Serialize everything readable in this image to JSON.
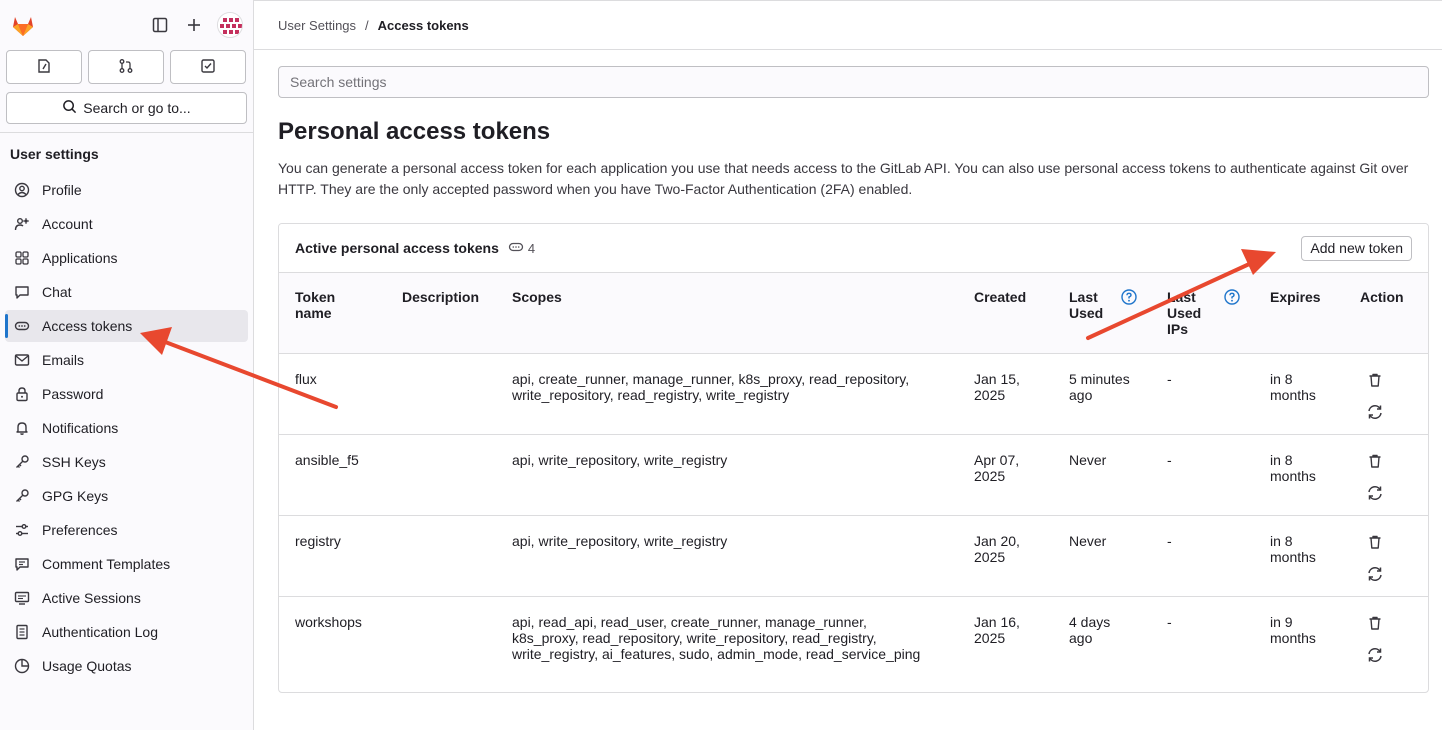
{
  "sidebar": {
    "search_label": "Search or go to...",
    "heading": "User settings",
    "items": [
      {
        "label": "Profile",
        "icon": "profile-icon"
      },
      {
        "label": "Account",
        "icon": "account-icon"
      },
      {
        "label": "Applications",
        "icon": "applications-icon"
      },
      {
        "label": "Chat",
        "icon": "chat-icon"
      },
      {
        "label": "Access tokens",
        "icon": "token-icon",
        "active": true
      },
      {
        "label": "Emails",
        "icon": "mail-icon"
      },
      {
        "label": "Password",
        "icon": "lock-icon"
      },
      {
        "label": "Notifications",
        "icon": "bell-icon"
      },
      {
        "label": "SSH Keys",
        "icon": "key-icon"
      },
      {
        "label": "GPG Keys",
        "icon": "key-icon"
      },
      {
        "label": "Preferences",
        "icon": "preferences-icon"
      },
      {
        "label": "Comment Templates",
        "icon": "comment-icon"
      },
      {
        "label": "Active Sessions",
        "icon": "monitor-icon"
      },
      {
        "label": "Authentication Log",
        "icon": "log-icon"
      },
      {
        "label": "Usage Quotas",
        "icon": "quota-icon"
      }
    ]
  },
  "breadcrumb": {
    "parent": "User Settings",
    "separator": "/",
    "current": "Access tokens"
  },
  "search": {
    "placeholder": "Search settings"
  },
  "page": {
    "title": "Personal access tokens",
    "description": "You can generate a personal access token for each application you use that needs access to the GitLab API. You can also use personal access tokens to authenticate against Git over HTTP. They are the only accepted password when you have Two-Factor Authentication (2FA) enabled."
  },
  "tokens_card": {
    "title": "Active personal access tokens",
    "count": "4",
    "add_button": "Add new token",
    "columns": [
      "Token name",
      "Description",
      "Scopes",
      "Created",
      "Last Used",
      "Last Used IPs",
      "Expires",
      "Action"
    ],
    "rows": [
      {
        "name": "flux",
        "description": "",
        "scopes": "api, create_runner, manage_runner, k8s_proxy, read_repository, write_repository, read_registry, write_registry",
        "created": "Jan 15, 2025",
        "last_used": "5 minutes ago",
        "last_used_ips": "-",
        "expires": "in 8 months"
      },
      {
        "name": "ansible_f5",
        "description": "",
        "scopes": "api, write_repository, write_registry",
        "created": "Apr 07, 2025",
        "last_used": "Never",
        "last_used_ips": "-",
        "expires": "in 8 months"
      },
      {
        "name": "registry",
        "description": "",
        "scopes": "api, write_repository, write_registry",
        "created": "Jan 20, 2025",
        "last_used": "Never",
        "last_used_ips": "-",
        "expires": "in 8 months"
      },
      {
        "name": "workshops",
        "description": "",
        "scopes": "api, read_api, read_user, create_runner, manage_runner, k8s_proxy, read_repository, write_repository, read_registry, write_registry, ai_features, sudo, admin_mode, read_service_ping",
        "created": "Jan 16, 2025",
        "last_used": "4 days ago",
        "last_used_ips": "-",
        "expires": "in 9 months"
      }
    ]
  },
  "colors": {
    "annotation_arrow": "#e8482f",
    "active_indicator": "#1f75cb",
    "help_icon": "#1f75cb",
    "logo": "#e24329"
  }
}
